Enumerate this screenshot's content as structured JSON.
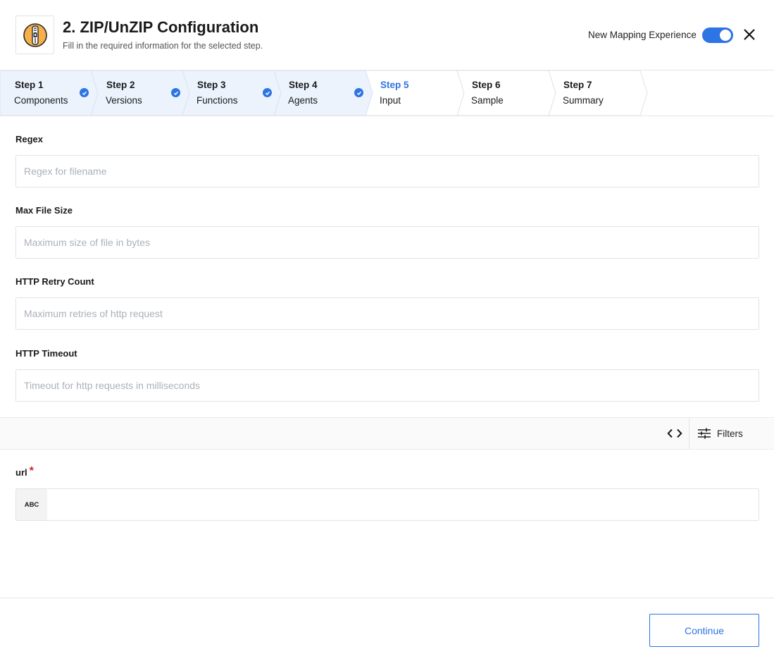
{
  "header": {
    "title": "2. ZIP/UnZIP Configuration",
    "subtitle": "Fill in the required information for the selected step.",
    "logo_icon": "zip-file-icon",
    "toggle_label": "New Mapping Experience",
    "toggle_on": true,
    "close_icon": "close-icon"
  },
  "colors": {
    "accent": "#2d74e4",
    "completed_step_bg": "#ecf3fd",
    "required": "#d8202a"
  },
  "steps": [
    {
      "num": "Step 1",
      "name": "Components",
      "status": "completed"
    },
    {
      "num": "Step 2",
      "name": "Versions",
      "status": "completed"
    },
    {
      "num": "Step 3",
      "name": "Functions",
      "status": "completed"
    },
    {
      "num": "Step 4",
      "name": "Agents",
      "status": "completed"
    },
    {
      "num": "Step 5",
      "name": "Input",
      "status": "active"
    },
    {
      "num": "Step 6",
      "name": "Sample",
      "status": "pending"
    },
    {
      "num": "Step 7",
      "name": "Summary",
      "status": "pending"
    }
  ],
  "fields": {
    "regex": {
      "label": "Regex",
      "placeholder": "Regex for filename",
      "value": ""
    },
    "max_file_size": {
      "label": "Max File Size",
      "placeholder": "Maximum size of file in bytes",
      "value": ""
    },
    "http_retry_count": {
      "label": "HTTP Retry Count",
      "placeholder": "Maximum retries of http request",
      "value": ""
    },
    "http_timeout": {
      "label": "HTTP Timeout",
      "placeholder": "Timeout for http requests in milliseconds",
      "value": ""
    }
  },
  "toolbar": {
    "code_icon": "code-brackets-icon",
    "filters_icon": "sliders-icon",
    "filters_label": "Filters"
  },
  "url_field": {
    "label": "url",
    "required_mark": "*",
    "type_badge": "ABC",
    "value": ""
  },
  "footer": {
    "continue_label": "Continue"
  }
}
